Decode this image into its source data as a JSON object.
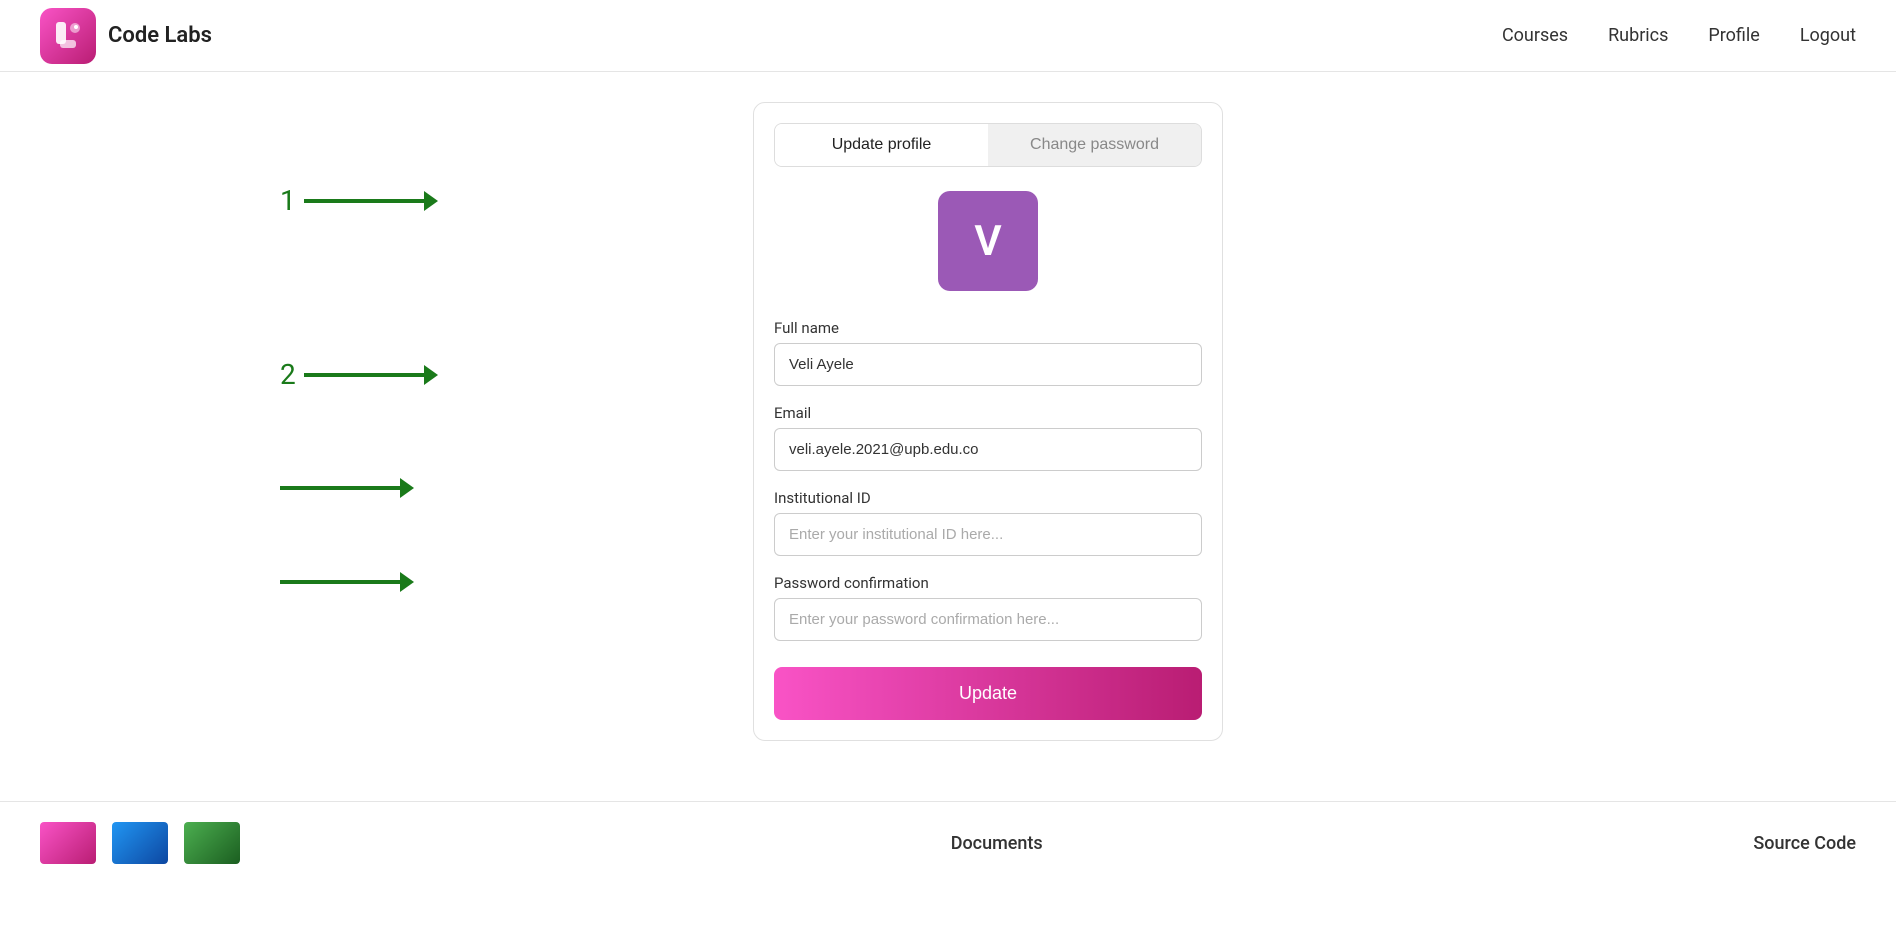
{
  "header": {
    "logo_text": "Code Labs",
    "nav": {
      "courses": "Courses",
      "rubrics": "Rubrics",
      "profile": "Profile",
      "logout": "Logout"
    }
  },
  "tabs": {
    "update_profile": "Update profile",
    "change_password": "Change password"
  },
  "avatar": {
    "initial": "V",
    "bg_color": "#9b59b6"
  },
  "form": {
    "full_name_label": "Full name",
    "full_name_value": "Veli Ayele",
    "email_label": "Email",
    "email_value": "veli.ayele.2021@upb.edu.co",
    "institutional_id_label": "Institutional ID",
    "institutional_id_placeholder": "Enter your institutional ID here...",
    "password_confirmation_label": "Password confirmation",
    "password_confirmation_placeholder": "Enter your password confirmation here...",
    "update_button": "Update"
  },
  "annotations": {
    "num1": "1",
    "num2": "2"
  },
  "footer": {
    "documents_label": "Documents",
    "source_code_label": "Source Code"
  }
}
